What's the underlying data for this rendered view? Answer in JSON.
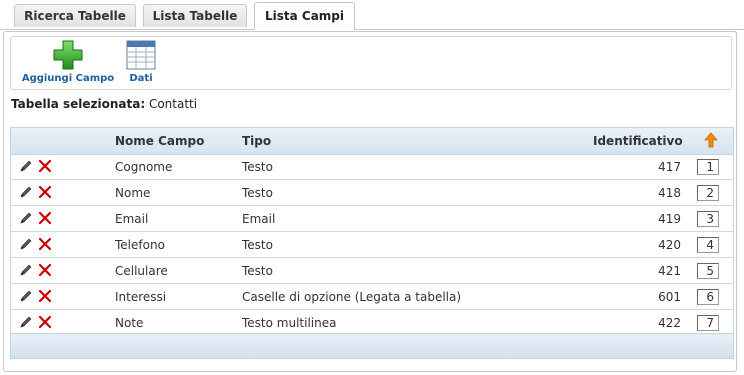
{
  "tabs": [
    {
      "label": "Ricerca Tabelle",
      "active": false
    },
    {
      "label": "Lista Tabelle",
      "active": false
    },
    {
      "label": "Lista Campi",
      "active": true
    }
  ],
  "toolbar": {
    "add_field_label": "Aggiungi Campo",
    "data_label": "Dati"
  },
  "selection": {
    "label": "Tabella selezionata:",
    "value": "Contatti"
  },
  "table": {
    "columns": {
      "name": "Nome Campo",
      "type": "Tipo",
      "id": "Identificativo"
    },
    "sort_icon": "arrow-up-icon",
    "rows": [
      {
        "name": "Cognome",
        "type": "Testo",
        "id": "417",
        "order": "1"
      },
      {
        "name": "Nome",
        "type": "Testo",
        "id": "418",
        "order": "2"
      },
      {
        "name": "Email",
        "type": "Email",
        "id": "419",
        "order": "3"
      },
      {
        "name": "Telefono",
        "type": "Testo",
        "id": "420",
        "order": "4"
      },
      {
        "name": "Cellulare",
        "type": "Testo",
        "id": "421",
        "order": "5"
      },
      {
        "name": "Interessi",
        "type": "Caselle di opzione (Legata a tabella)",
        "id": "601",
        "order": "6"
      },
      {
        "name": "Note",
        "type": "Testo multilinea",
        "id": "422",
        "order": "7"
      }
    ]
  },
  "colors": {
    "accent": "#1e5f9e",
    "header_bg": "#d5e4f0",
    "delete_red": "#cc0000",
    "add_green": "#3aa832",
    "sort_orange": "#f08c00"
  }
}
